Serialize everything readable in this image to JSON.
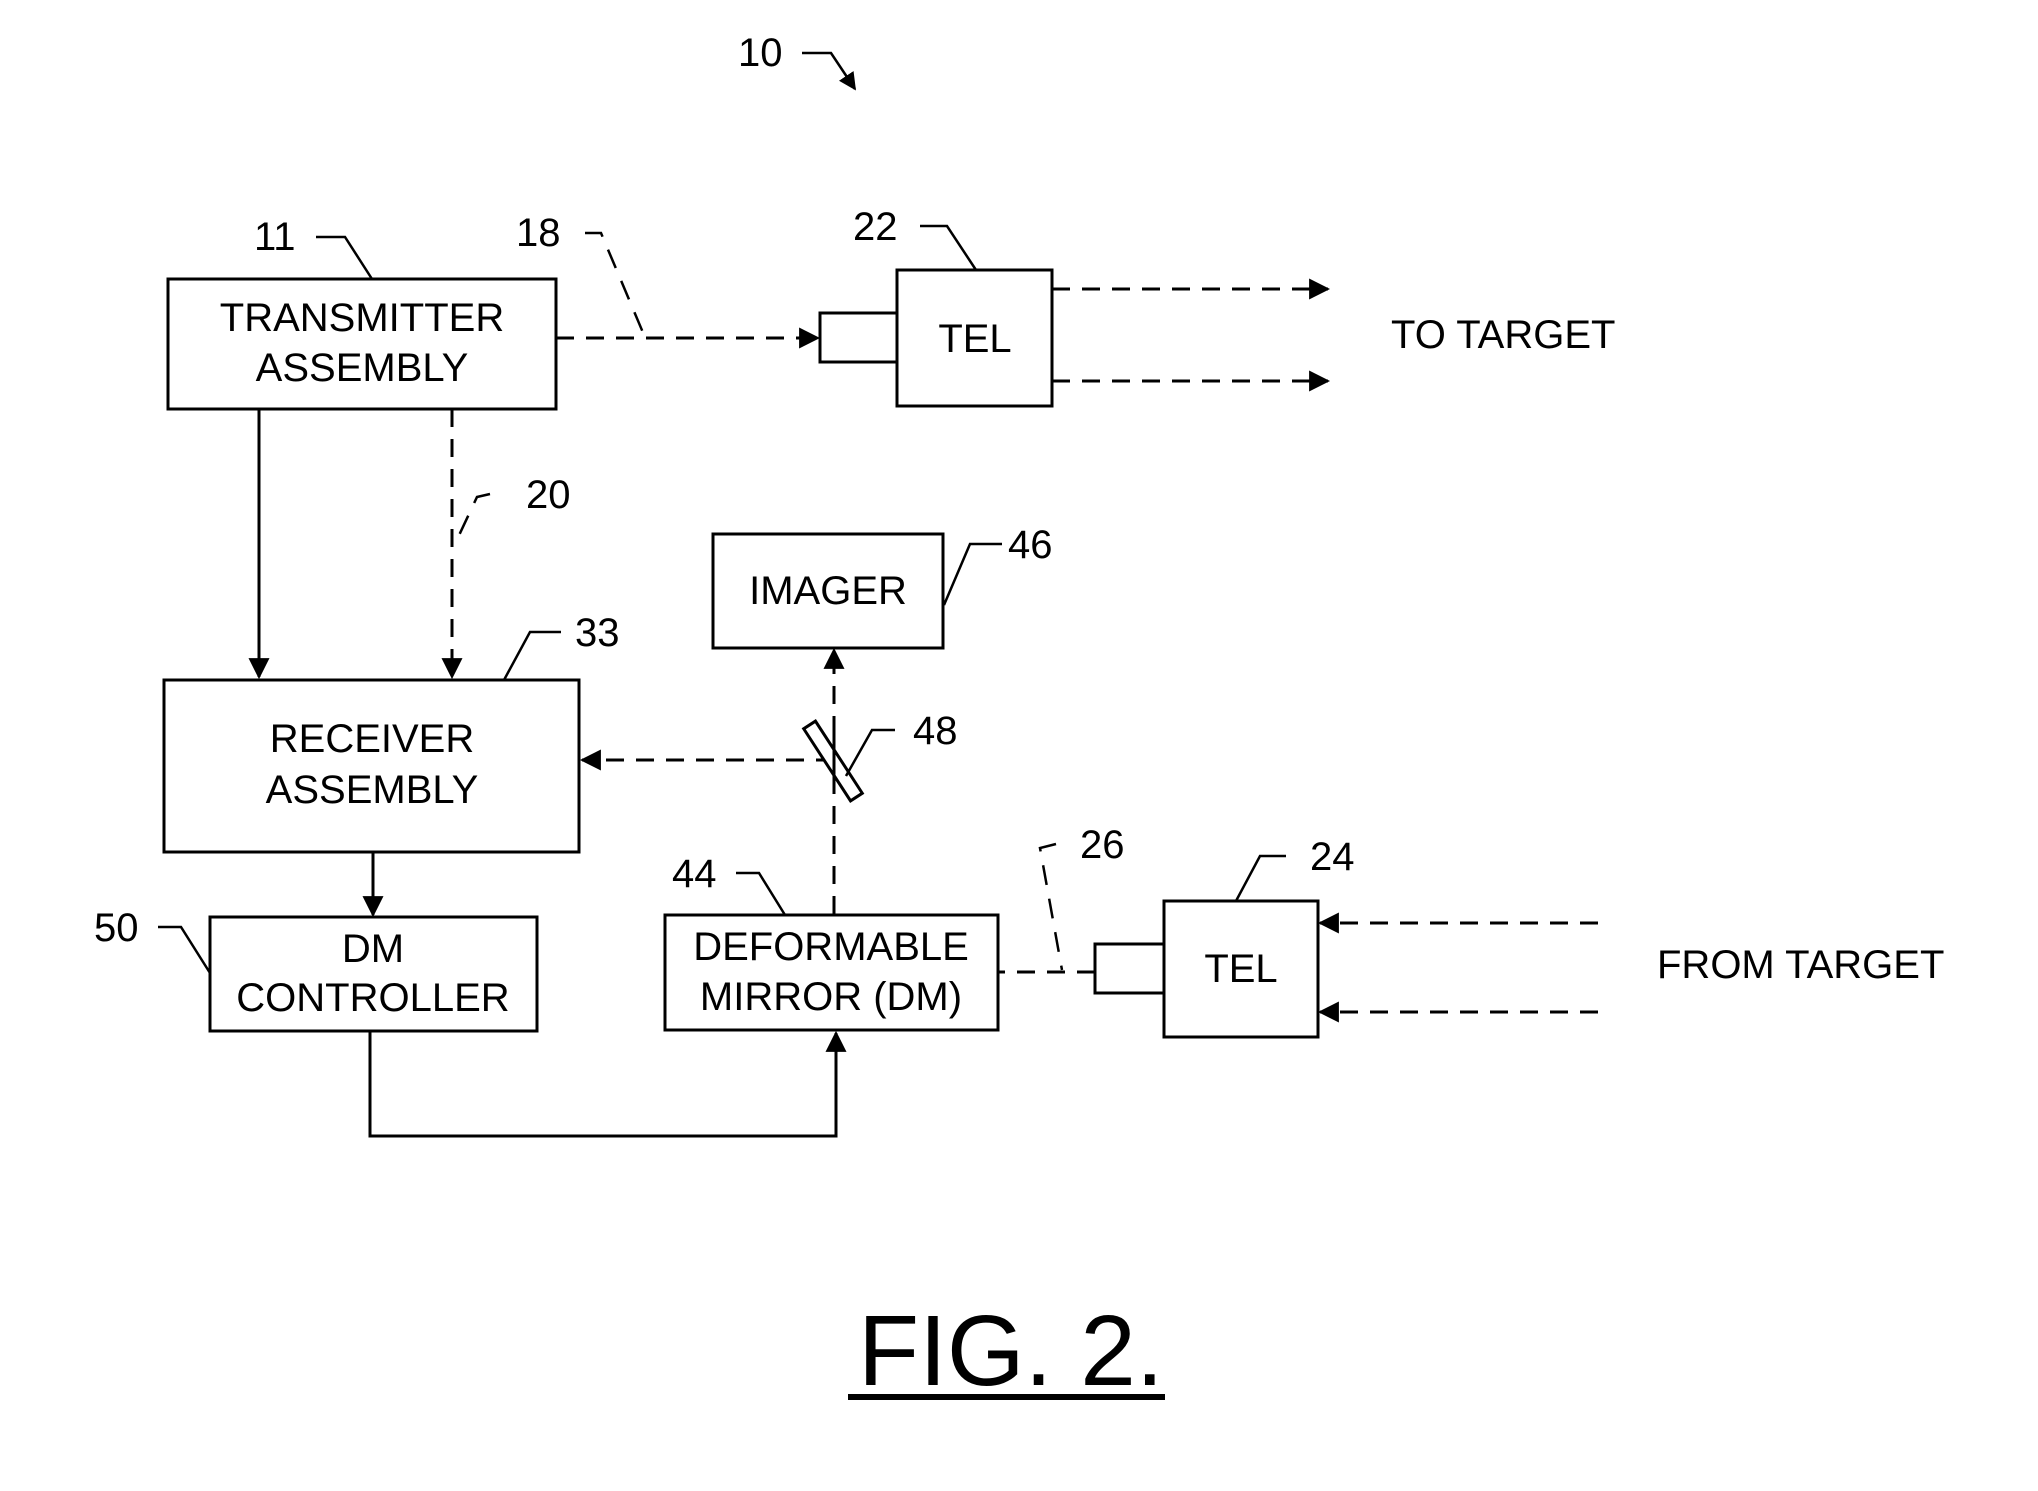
{
  "figure": {
    "ref": "10",
    "caption": "FIG. 2."
  },
  "blocks": {
    "transmitter": {
      "ref": "11",
      "line1": "TRANSMITTER",
      "line2": "ASSEMBLY"
    },
    "tel_tx": {
      "ref": "22",
      "label": "TEL"
    },
    "receiver": {
      "ref": "33",
      "line1": "RECEIVER",
      "line2": "ASSEMBLY"
    },
    "imager": {
      "ref": "46",
      "label": "IMAGER"
    },
    "beam_splitter": {
      "ref": "48"
    },
    "dm_controller": {
      "ref": "50",
      "line1": "DM",
      "line2": "CONTROLLER"
    },
    "deformable_mirror": {
      "ref": "44",
      "line1": "DEFORMABLE",
      "line2": "MIRROR (DM)"
    },
    "tel_rx": {
      "ref": "24",
      "label": "TEL"
    }
  },
  "paths": {
    "tx_beam": {
      "ref": "18"
    },
    "ref_beam": {
      "ref": "20"
    },
    "rx_beam": {
      "ref": "26"
    }
  },
  "annotations": {
    "to_target": "TO TARGET",
    "from_target": "FROM TARGET"
  }
}
